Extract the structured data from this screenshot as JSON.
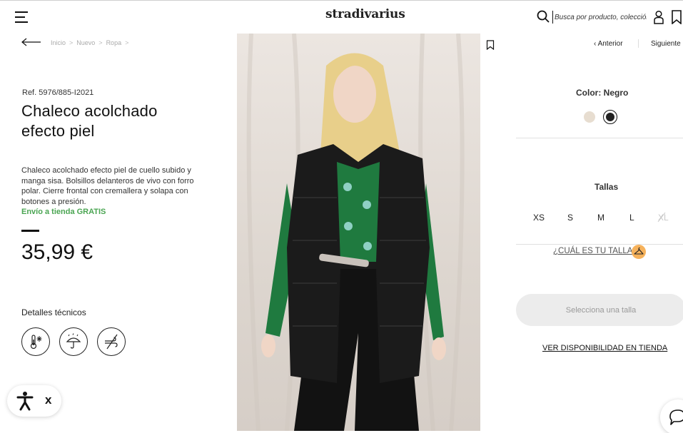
{
  "header": {
    "logo": "stradivarius",
    "search_placeholder": "Busca por producto, colección..."
  },
  "breadcrumb": [
    "Inicio",
    "Nuevo",
    "Ropa"
  ],
  "breadcrumb_sep": ">",
  "product": {
    "ref": "Ref. 5976/885-I2021",
    "title": "Chaleco acolchado efecto piel",
    "description": "Chaleco acolchado efecto piel de cuello subido y manga sisa. Bolsillos delanteros de vivo con forro polar. Cierre frontal con cremallera y solapa con botones a presión.",
    "shipping": "Envío a tienda GRATIS",
    "price": "35,99 €",
    "tech_details_label": "Detalles técnicos",
    "tech_icons": [
      "thermometer-snow-icon",
      "umbrella-rain-icon",
      "wind-icon"
    ]
  },
  "nav": {
    "prev": "Anterior",
    "next": "Siguiente"
  },
  "color": {
    "label": "Color: Negro",
    "swatches": [
      {
        "name": "beige",
        "hex": "#e7ddd0"
      },
      {
        "name": "negro",
        "hex": "#222222",
        "selected": true
      }
    ]
  },
  "sizes": {
    "label": "Tallas",
    "items": [
      {
        "label": "XS",
        "available": true
      },
      {
        "label": "S",
        "available": true
      },
      {
        "label": "M",
        "available": true
      },
      {
        "label": "L",
        "available": true
      },
      {
        "label": "XL",
        "available": false
      }
    ]
  },
  "size_guide": "¿CUÁL ES TU TALLA?",
  "select_size_button": "Selecciona una talla",
  "store_availability": "VER DISPONIBILIDAD EN TIENDA",
  "accessibility": {
    "close": "x"
  },
  "colors": {
    "accent_green": "#4aa552",
    "size_badge": "#f6b25c"
  }
}
